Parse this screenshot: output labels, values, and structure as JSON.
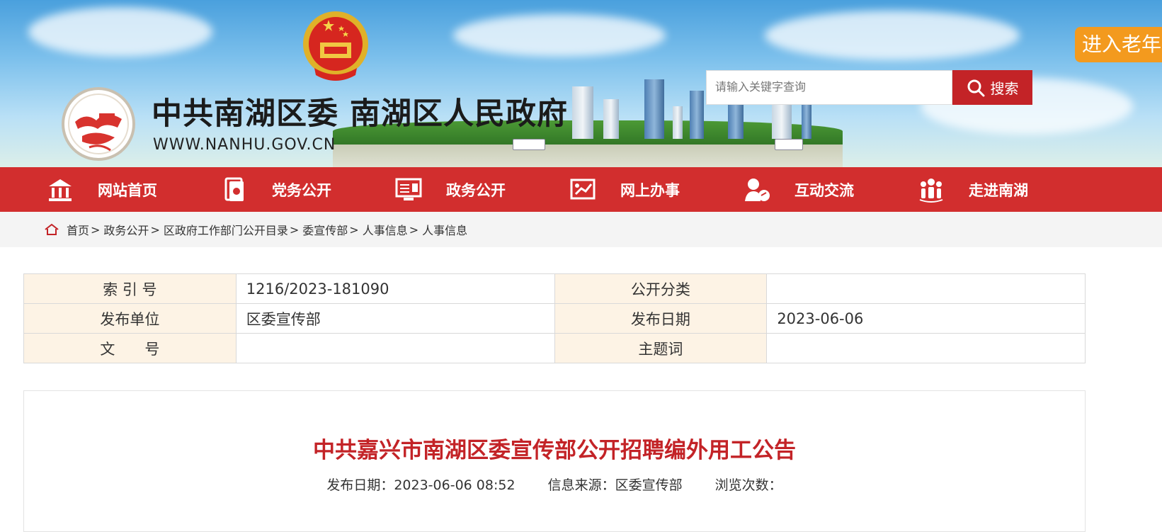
{
  "header": {
    "title": "中共南湖区委 南湖区人民政府",
    "url": "WWW.NANHU.GOV.CN",
    "search_placeholder": "请输入关键字查询",
    "search_button": "搜索",
    "elder_mode": "进入老年"
  },
  "nav": {
    "items": [
      {
        "label": "网站首页",
        "icon": "temple-icon"
      },
      {
        "label": "党务公开",
        "icon": "party-emblem-icon"
      },
      {
        "label": "政务公开",
        "icon": "monitor-icon"
      },
      {
        "label": "网上办事",
        "icon": "presentation-icon"
      },
      {
        "label": "互动交流",
        "icon": "user-chat-icon"
      },
      {
        "label": "走进南湖",
        "icon": "people-group-icon"
      }
    ]
  },
  "breadcrumb": [
    "首页",
    "政务公开",
    "区政府工作部门公开目录",
    "委宣传部",
    "人事信息",
    "人事信息"
  ],
  "meta": {
    "rows": [
      {
        "k1": "索 引 号",
        "v1": "1216/2023-181090",
        "k2": "公开分类",
        "v2": ""
      },
      {
        "k1": "发布单位",
        "v1": "区委宣传部",
        "k2": "发布日期",
        "v2": "2023-06-06"
      },
      {
        "k1": "文　　号",
        "v1": "",
        "k2": "主题词",
        "v2": ""
      }
    ]
  },
  "article": {
    "title": "中共嘉兴市南湖区委宣传部公开招聘编外用工公告",
    "publish": "发布日期：2023-06-06 08:52",
    "source": "信息来源：区委宣传部",
    "views": "浏览次数："
  },
  "colors": {
    "brand_red": "#d22e2e",
    "button_red": "#c32327",
    "orange": "#f39a1e",
    "meta_key_bg": "#fdf3e5"
  }
}
